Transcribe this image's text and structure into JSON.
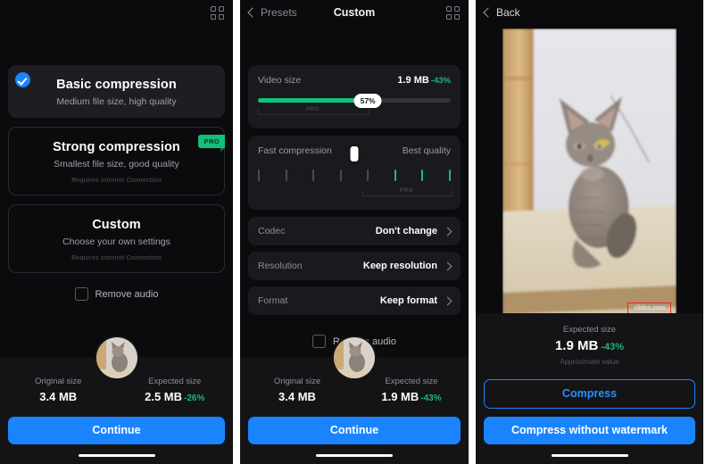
{
  "screen1": {
    "header": {
      "grid_icon": "grid-icon"
    },
    "presets": [
      {
        "title": "Basic compression",
        "subtitle": "Medium file size, high quality",
        "selected": true,
        "note": "",
        "badge": ""
      },
      {
        "title": "Strong compression",
        "subtitle": "Smallest file size, good quality",
        "selected": false,
        "note": "Requires Internet Connection",
        "badge": "PRO"
      },
      {
        "title": "Custom",
        "subtitle": "Choose your own settings",
        "selected": false,
        "note": "Requires Internet Connection",
        "badge": ""
      }
    ],
    "remove_audio_label": "Remove audio",
    "original_size_label": "Original size",
    "original_size_value": "3.4 MB",
    "expected_size_label": "Expected size",
    "expected_size_value": "2.5 MB",
    "expected_size_delta": "-26%",
    "continue_label": "Continue"
  },
  "screen2": {
    "header": {
      "back_label": "Presets",
      "title": "Custom",
      "grid_icon": "grid-icon"
    },
    "video_size": {
      "label": "Video size",
      "value": "1.9 MB",
      "delta": "-43%",
      "percent": "57%",
      "percent_number": 57,
      "pro_label": "PRO"
    },
    "quality": {
      "left_label": "Fast compression",
      "right_label": "Best quality",
      "pro_label": "PRO",
      "ticks": [
        "gray",
        "gray",
        "gray",
        "gray",
        "thumb",
        "gray",
        "green",
        "green",
        "green"
      ]
    },
    "options": [
      {
        "label": "Codec",
        "value": "Don't change"
      },
      {
        "label": "Resolution",
        "value": "Keep resolution"
      },
      {
        "label": "Format",
        "value": "Keep format"
      }
    ],
    "remove_audio_label": "Remove audio",
    "original_size_label": "Original size",
    "original_size_value": "3.4 MB",
    "expected_size_label": "Expected size",
    "expected_size_value": "1.9 MB",
    "expected_size_delta": "-43%",
    "continue_label": "Continue"
  },
  "screen3": {
    "header": {
      "back_label": "Back"
    },
    "watermark_text": "clideo.com",
    "expected_size_label": "Expected size",
    "expected_size_value": "1.9 MB",
    "expected_size_delta": "-43%",
    "approximate_note": "Approximate value",
    "compress_label": "Compress",
    "compress_no_watermark_label": "Compress without watermark"
  },
  "colors": {
    "accent_blue": "#1a84ff",
    "accent_green": "#12c079",
    "background": "#0b0b0d",
    "card": "#1e1e22",
    "panel": "#1a1a1e",
    "watermark_outline": "#ef2626"
  }
}
